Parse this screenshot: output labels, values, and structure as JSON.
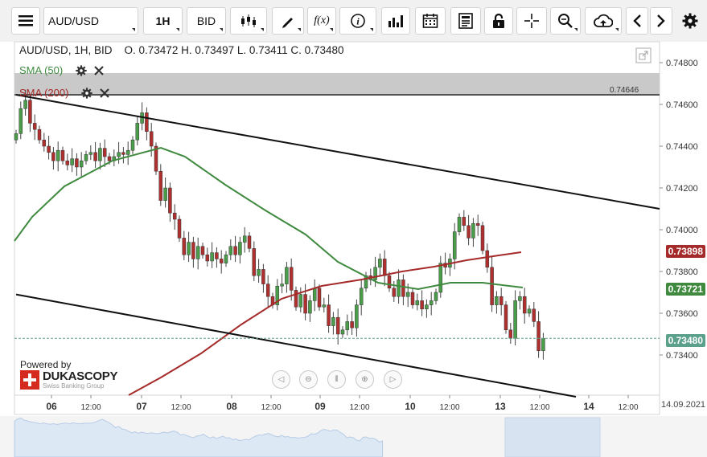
{
  "toolbar": {
    "menu_icon": "hamburger-icon",
    "instrument": "AUD/USD",
    "timeframe": "1H",
    "side": "BID",
    "fx_label": "f(x)",
    "info_label": "i",
    "icons": [
      "candles-icon",
      "pen-icon",
      "function-icon",
      "info-icon",
      "bar-chart-icon",
      "calendar-icon",
      "news-icon",
      "lock-icon",
      "crosshair-icon",
      "zoom-icon",
      "cloud-upload-icon",
      "chevron-left-icon",
      "chevron-right-icon",
      "gear-icon"
    ]
  },
  "chart_info": "AUD/USD, 1H, BID    O. 0.73472 H. 0.73497 L. 0.73411 C. 0.73480",
  "indicators": {
    "sma50_label": "SMA (50)",
    "sma200_label": "SMA (200)"
  },
  "price_labels": {
    "sma200_value": "0.73898",
    "sma50_value": "0.73721",
    "last_value": "0.73480",
    "hline_value": "0.74646"
  },
  "branding": {
    "powered": "Powered by",
    "name": "DUKASCOPY",
    "sub": "Swiss Banking Group"
  },
  "date_box": "14.09.2021",
  "colors": {
    "up": "#4a9e4a",
    "down": "#b03030",
    "sma50": "#3f8a3f",
    "sma200": "#a52a2a",
    "trend": "#111111",
    "band": "#c9c9c9",
    "last": "#5aa08a"
  },
  "chart_data": {
    "type": "candlestick",
    "title": "AUD/USD, 1H, BID",
    "ylim": [
      0.733,
      0.749
    ],
    "yticks": [
      "0.74800",
      "0.74600",
      "0.74400",
      "0.74200",
      "0.74000",
      "0.73800",
      "0.73600",
      "0.73400"
    ],
    "x_ticks": [
      "06",
      "12:00",
      "07",
      "12:00",
      "08",
      "12:00",
      "09",
      "12:00",
      "10",
      "12:00",
      "13",
      "12:00",
      "14",
      "12:00"
    ],
    "ohlc": {
      "open": 0.73472,
      "high": 0.73497,
      "low": 0.73411,
      "close": 0.7348
    },
    "horizontal_line": 0.74646,
    "channel_upper": [
      [
        0,
        0.74646
      ],
      [
        144,
        0.741
      ]
    ],
    "channel_lower": [
      [
        0,
        0.7369
      ],
      [
        144,
        0.732
      ]
    ],
    "closes": [
      0.7446,
      0.7458,
      0.7462,
      0.7451,
      0.7448,
      0.7443,
      0.744,
      0.7437,
      0.7433,
      0.7438,
      0.7433,
      0.7431,
      0.7434,
      0.743,
      0.7433,
      0.7436,
      0.7437,
      0.7433,
      0.7439,
      0.7435,
      0.7433,
      0.7435,
      0.7437,
      0.7436,
      0.7438,
      0.7443,
      0.7451,
      0.7456,
      0.7447,
      0.744,
      0.7428,
      0.7414,
      0.742,
      0.7408,
      0.7405,
      0.7396,
      0.7388,
      0.7394,
      0.7386,
      0.7392,
      0.7388,
      0.7385,
      0.7389,
      0.7386,
      0.7384,
      0.7388,
      0.7392,
      0.7388,
      0.7394,
      0.7397,
      0.7391,
      0.7378,
      0.7381,
      0.7374,
      0.7368,
      0.7364,
      0.7373,
      0.7374,
      0.7382,
      0.7371,
      0.7363,
      0.7369,
      0.736,
      0.7366,
      0.7372,
      0.7363,
      0.7364,
      0.7354,
      0.7358,
      0.735,
      0.7352,
      0.7356,
      0.7353,
      0.7364,
      0.7372,
      0.7378,
      0.7376,
      0.7382,
      0.7386,
      0.7378,
      0.7372,
      0.7368,
      0.7376,
      0.7368,
      0.737,
      0.7364,
      0.7366,
      0.7362,
      0.7364,
      0.7366,
      0.737,
      0.7384,
      0.7382,
      0.7386,
      0.7399,
      0.7406,
      0.7402,
      0.7396,
      0.7403,
      0.7402,
      0.739,
      0.7382,
      0.7364,
      0.7368,
      0.7364,
      0.7352,
      0.7348,
      0.7366,
      0.7368,
      0.736,
      0.7362,
      0.7356,
      0.7342,
      0.7348
    ]
  }
}
